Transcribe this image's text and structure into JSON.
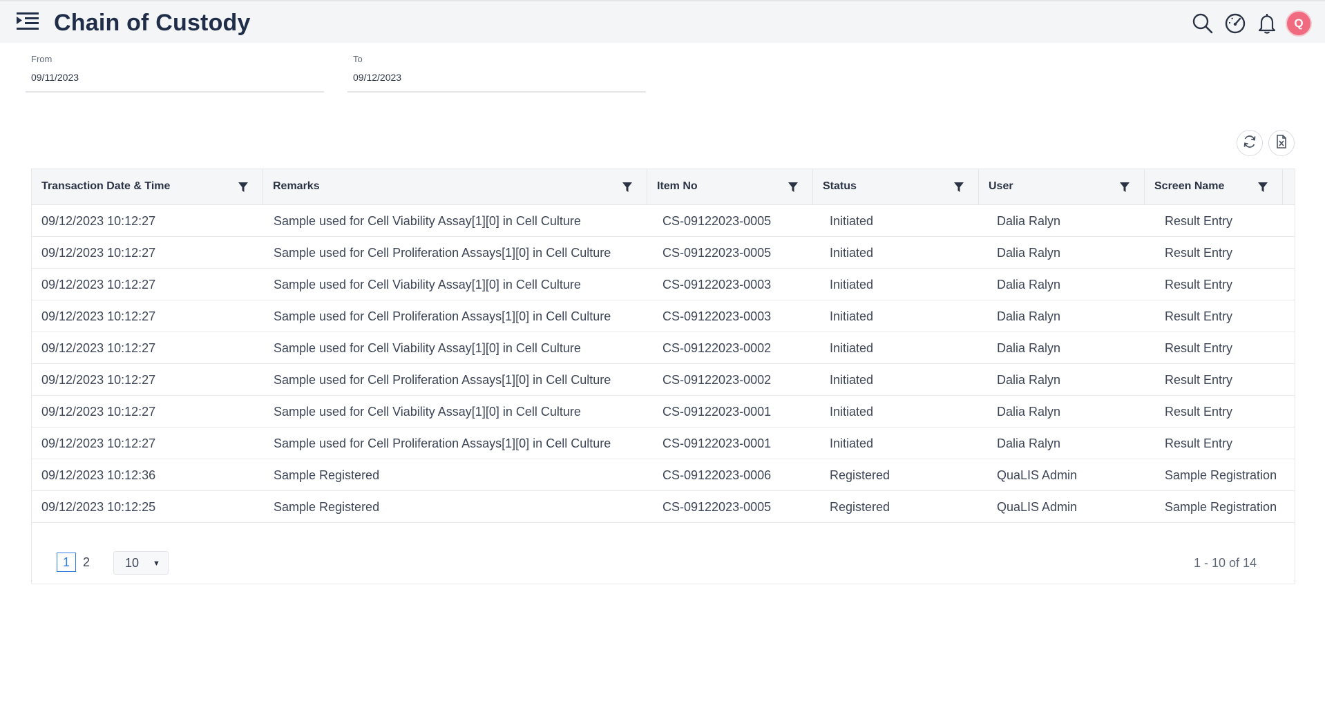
{
  "header": {
    "title": "Chain of Custody",
    "avatar_initial": "Q"
  },
  "filters": {
    "from_label": "From",
    "from_value": "09/11/2023",
    "to_label": "To",
    "to_value": "09/12/2023"
  },
  "grid": {
    "columns": [
      "Transaction Date & Time",
      "Remarks",
      "Item No",
      "Status",
      "User",
      "Screen Name"
    ],
    "rows": [
      [
        "09/12/2023 10:12:27",
        "Sample used for Cell Viability Assay[1][0] in Cell Culture",
        "CS-09122023-0005",
        "Initiated",
        "Dalia Ralyn",
        "Result Entry"
      ],
      [
        "09/12/2023 10:12:27",
        "Sample used for Cell Proliferation Assays[1][0] in Cell Culture",
        "CS-09122023-0005",
        "Initiated",
        "Dalia Ralyn",
        "Result Entry"
      ],
      [
        "09/12/2023 10:12:27",
        "Sample used for Cell Viability Assay[1][0] in Cell Culture",
        "CS-09122023-0003",
        "Initiated",
        "Dalia Ralyn",
        "Result Entry"
      ],
      [
        "09/12/2023 10:12:27",
        "Sample used for Cell Proliferation Assays[1][0] in Cell Culture",
        "CS-09122023-0003",
        "Initiated",
        "Dalia Ralyn",
        "Result Entry"
      ],
      [
        "09/12/2023 10:12:27",
        "Sample used for Cell Viability Assay[1][0] in Cell Culture",
        "CS-09122023-0002",
        "Initiated",
        "Dalia Ralyn",
        "Result Entry"
      ],
      [
        "09/12/2023 10:12:27",
        "Sample used for Cell Proliferation Assays[1][0] in Cell Culture",
        "CS-09122023-0002",
        "Initiated",
        "Dalia Ralyn",
        "Result Entry"
      ],
      [
        "09/12/2023 10:12:27",
        "Sample used for Cell Viability Assay[1][0] in Cell Culture",
        "CS-09122023-0001",
        "Initiated",
        "Dalia Ralyn",
        "Result Entry"
      ],
      [
        "09/12/2023 10:12:27",
        "Sample used for Cell Proliferation Assays[1][0] in Cell Culture",
        "CS-09122023-0001",
        "Initiated",
        "Dalia Ralyn",
        "Result Entry"
      ],
      [
        "09/12/2023 10:12:36",
        "Sample Registered",
        "CS-09122023-0006",
        "Registered",
        "QuaLIS Admin",
        "Sample Registration"
      ],
      [
        "09/12/2023 10:12:25",
        "Sample Registered",
        "CS-09122023-0005",
        "Registered",
        "QuaLIS Admin",
        "Sample Registration"
      ]
    ]
  },
  "pager": {
    "pages": [
      "1",
      "2"
    ],
    "current_page": "1",
    "page_size": "10",
    "info": "1 - 10 of 14"
  },
  "icons": {
    "menu": "menu-toggle-icon",
    "search": "search-icon",
    "dashboard": "speedometer-icon",
    "notifications": "bell-icon",
    "refresh": "refresh-icon",
    "export": "excel-export-icon",
    "filter": "filter-icon"
  },
  "colors": {
    "title": "#1f2d48",
    "avatar": "#f06b7f",
    "active_page": "#2f7de1"
  }
}
